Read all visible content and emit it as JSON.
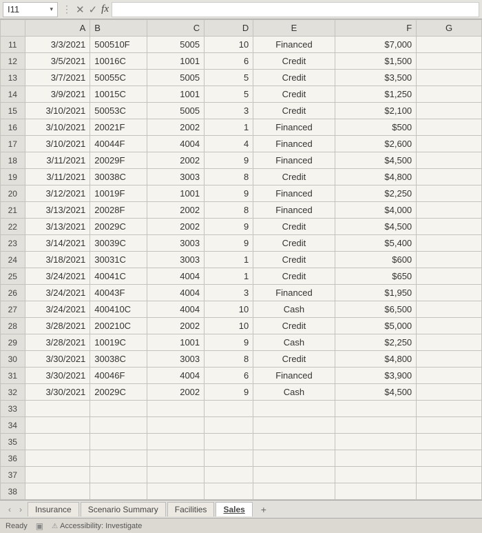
{
  "formulaBar": {
    "nameBox": "I11",
    "cancel": "✕",
    "confirm": "✓",
    "fx": "fx"
  },
  "columns": [
    "A",
    "B",
    "C",
    "D",
    "E",
    "F",
    "G"
  ],
  "rows": [
    {
      "n": 11,
      "A": "3/3/2021",
      "B": "500510F",
      "C": "5005",
      "D": "10",
      "E": "Financed",
      "F": "$7,000"
    },
    {
      "n": 12,
      "A": "3/5/2021",
      "B": "10016C",
      "C": "1001",
      "D": "6",
      "E": "Credit",
      "F": "$1,500"
    },
    {
      "n": 13,
      "A": "3/7/2021",
      "B": "50055C",
      "C": "5005",
      "D": "5",
      "E": "Credit",
      "F": "$3,500"
    },
    {
      "n": 14,
      "A": "3/9/2021",
      "B": "10015C",
      "C": "1001",
      "D": "5",
      "E": "Credit",
      "F": "$1,250"
    },
    {
      "n": 15,
      "A": "3/10/2021",
      "B": "50053C",
      "C": "5005",
      "D": "3",
      "E": "Credit",
      "F": "$2,100"
    },
    {
      "n": 16,
      "A": "3/10/2021",
      "B": "20021F",
      "C": "2002",
      "D": "1",
      "E": "Financed",
      "F": "$500"
    },
    {
      "n": 17,
      "A": "3/10/2021",
      "B": "40044F",
      "C": "4004",
      "D": "4",
      "E": "Financed",
      "F": "$2,600"
    },
    {
      "n": 18,
      "A": "3/11/2021",
      "B": "20029F",
      "C": "2002",
      "D": "9",
      "E": "Financed",
      "F": "$4,500"
    },
    {
      "n": 19,
      "A": "3/11/2021",
      "B": "30038C",
      "C": "3003",
      "D": "8",
      "E": "Credit",
      "F": "$4,800"
    },
    {
      "n": 20,
      "A": "3/12/2021",
      "B": "10019F",
      "C": "1001",
      "D": "9",
      "E": "Financed",
      "F": "$2,250"
    },
    {
      "n": 21,
      "A": "3/13/2021",
      "B": "20028F",
      "C": "2002",
      "D": "8",
      "E": "Financed",
      "F": "$4,000"
    },
    {
      "n": 22,
      "A": "3/13/2021",
      "B": "20029C",
      "C": "2002",
      "D": "9",
      "E": "Credit",
      "F": "$4,500"
    },
    {
      "n": 23,
      "A": "3/14/2021",
      "B": "30039C",
      "C": "3003",
      "D": "9",
      "E": "Credit",
      "F": "$5,400"
    },
    {
      "n": 24,
      "A": "3/18/2021",
      "B": "30031C",
      "C": "3003",
      "D": "1",
      "E": "Credit",
      "F": "$600"
    },
    {
      "n": 25,
      "A": "3/24/2021",
      "B": "40041C",
      "C": "4004",
      "D": "1",
      "E": "Credit",
      "F": "$650"
    },
    {
      "n": 26,
      "A": "3/24/2021",
      "B": "40043F",
      "C": "4004",
      "D": "3",
      "E": "Financed",
      "F": "$1,950"
    },
    {
      "n": 27,
      "A": "3/24/2021",
      "B": "400410C",
      "C": "4004",
      "D": "10",
      "E": "Cash",
      "F": "$6,500"
    },
    {
      "n": 28,
      "A": "3/28/2021",
      "B": "200210C",
      "C": "2002",
      "D": "10",
      "E": "Credit",
      "F": "$5,000"
    },
    {
      "n": 29,
      "A": "3/28/2021",
      "B": "10019C",
      "C": "1001",
      "D": "9",
      "E": "Cash",
      "F": "$2,250"
    },
    {
      "n": 30,
      "A": "3/30/2021",
      "B": "30038C",
      "C": "3003",
      "D": "8",
      "E": "Credit",
      "F": "$4,800"
    },
    {
      "n": 31,
      "A": "3/30/2021",
      "B": "40046F",
      "C": "4004",
      "D": "6",
      "E": "Financed",
      "F": "$3,900"
    },
    {
      "n": 32,
      "A": "3/30/2021",
      "B": "20029C",
      "C": "2002",
      "D": "9",
      "E": "Cash",
      "F": "$4,500"
    }
  ],
  "emptyRows": [
    33,
    34,
    35,
    36,
    37,
    38
  ],
  "sheetTabs": {
    "prev": "‹",
    "next": "›",
    "tabs": [
      "Insurance",
      "Scenario Summary",
      "Facilities",
      "Sales"
    ],
    "activeIndex": 3,
    "add": "+"
  },
  "statusBar": {
    "ready": "Ready",
    "accessibility": "Accessibility: Investigate"
  }
}
